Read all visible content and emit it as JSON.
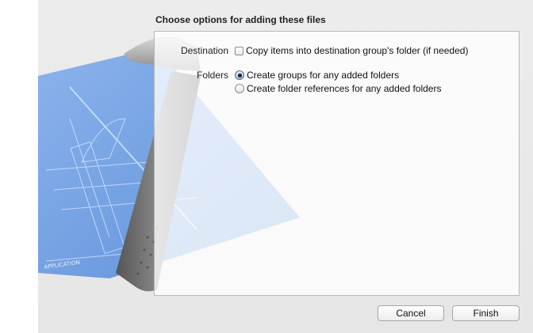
{
  "dialog": {
    "title": "Choose options for adding these files"
  },
  "destination": {
    "label": "Destination",
    "option_label": "Copy items into destination group's folder (if needed)",
    "checked": false
  },
  "folders": {
    "label": "Folders",
    "options": [
      {
        "label": "Create groups for any added folders",
        "selected": true
      },
      {
        "label": "Create folder references for any added folders",
        "selected": false
      }
    ]
  },
  "buttons": {
    "cancel": "Cancel",
    "finish": "Finish"
  },
  "artwork": {
    "blueprint_text": "APPLICATION",
    "blueprint_color": "#6f9ee0",
    "icon": "xcode-hammer-blueprint-icon"
  }
}
